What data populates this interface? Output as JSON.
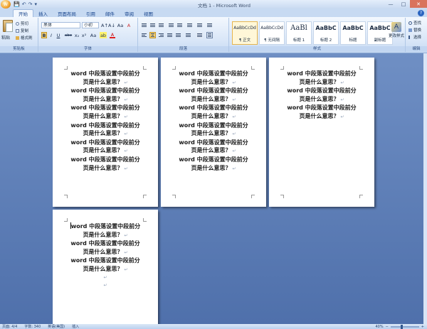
{
  "window": {
    "title": "文档 1 - Microsoft Word",
    "office_button": "W",
    "qat": [
      "💾",
      "↶",
      "↷",
      "▾"
    ],
    "controls": [
      "—",
      "□",
      "✕"
    ]
  },
  "tabs": [
    "开始",
    "插入",
    "页面布局",
    "引用",
    "邮件",
    "审阅",
    "视图"
  ],
  "ribbon": {
    "clipboard": {
      "paste": "粘贴",
      "cut": "剪切",
      "copy": "复制",
      "format_painter": "格式刷",
      "label": "剪贴板"
    },
    "font": {
      "font_name": "黑体",
      "font_size": "小初",
      "label": "字体",
      "buttons_row1": [
        "A↑",
        "A↓",
        "Aa",
        "A"
      ],
      "buttons_row2": [
        "B",
        "I",
        "U",
        "abe",
        "x₂",
        "x²",
        "Aa"
      ],
      "highlight": "ab",
      "font_color": "A"
    },
    "paragraph": {
      "label": "段落"
    },
    "styles": {
      "label": "样式",
      "items": [
        {
          "sample": "AaBbCcDd",
          "name": "¶ 正文"
        },
        {
          "sample": "AaBbCcDd",
          "name": "¶ 无间隔"
        },
        {
          "sample": "AaBl",
          "name": "标题 1"
        },
        {
          "sample": "AaBbC",
          "name": "标题 2"
        },
        {
          "sample": "AaBbC",
          "name": "标题"
        },
        {
          "sample": "AaBbC",
          "name": "副标题"
        }
      ],
      "change_styles": "更改样式",
      "change_styles_glyph": "A"
    },
    "editing": {
      "label": "编辑",
      "find": "查找",
      "replace": "替换",
      "select": "选择"
    }
  },
  "document": {
    "line1": "word 中段落设置中段前分",
    "line2": "页是什么意思？",
    "paragraph_mark": "↵",
    "pages": [
      {
        "paragraphs": 6
      },
      {
        "paragraphs": 6
      },
      {
        "paragraphs": 3
      },
      {
        "paragraphs": 3,
        "empty_marks": 2
      }
    ]
  },
  "status": {
    "page": "页面: 4/4",
    "words": "字数: 340",
    "language": "英语(美国)",
    "mode": "插入",
    "zoom": "40%"
  }
}
